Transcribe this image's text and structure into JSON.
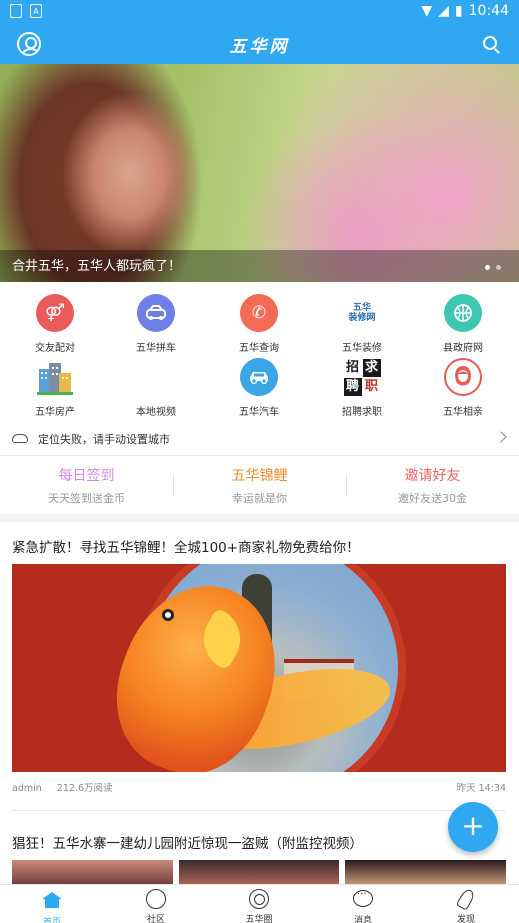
{
  "status_bar": {
    "time": "10:44"
  },
  "nav": {
    "title": "五华网"
  },
  "banner": {
    "caption": "合井五华，五华人都玩疯了！",
    "slide_count": 2,
    "active_slide": 1
  },
  "grid": [
    {
      "label": "交友配对",
      "icon": "gender-match-icon",
      "color": "#e95a5a",
      "glyph": "⚤"
    },
    {
      "label": "五华拼车",
      "icon": "car-share-icon",
      "color": "#6f7fe8",
      "glyph": "🚘"
    },
    {
      "label": "五华查询",
      "icon": "phone-icon",
      "color": "#f36a55",
      "glyph": "✆"
    },
    {
      "label": "五华装修",
      "icon": "renovation-logo-icon",
      "color": "#2a6db5",
      "glyph": "五华装修网"
    },
    {
      "label": "县政府网",
      "icon": "basketball-icon",
      "color": "#3dc6b0",
      "glyph": "◍"
    },
    {
      "label": "五华房产",
      "icon": "buildings-icon",
      "color": "#5aa0d8",
      "glyph": ""
    },
    {
      "label": "本地视频",
      "icon": "video-icon",
      "color": "#ffffff",
      "glyph": ""
    },
    {
      "label": "五华汽车",
      "icon": "car-icon",
      "color": "#3aa6e6",
      "glyph": "🚗"
    },
    {
      "label": "招聘求职",
      "icon": "recruit-logo-icon",
      "color": "#1a1a1a",
      "glyph": "招求聘职"
    },
    {
      "label": "五华相亲",
      "icon": "dating-portrait-icon",
      "color": "#e95a5a",
      "glyph": ""
    }
  ],
  "location": {
    "text": "定位失败，请手动设置城市"
  },
  "promos": [
    {
      "title": "每日签到",
      "subtitle": "天天签到送金币",
      "color": "#d48be6"
    },
    {
      "title": "五华锦鲤",
      "subtitle": "幸运就是你",
      "color": "#f08a2a"
    },
    {
      "title": "邀请好友",
      "subtitle": "邀好友送30金",
      "color": "#f06262"
    }
  ],
  "articles": [
    {
      "title": "紧急扩散！寻找五华锦鲤！全城100+商家礼物免费给你！",
      "author": "admin",
      "views": "212.6万阅读",
      "time": "昨天 14:34"
    },
    {
      "title": "猖狂！五华水寨一建幼儿园附近惊现一盗贼（附监控视频）"
    }
  ],
  "fab": {
    "label": "+"
  },
  "tabs": [
    {
      "label": "首页",
      "active": true
    },
    {
      "label": "社区",
      "active": false
    },
    {
      "label": "五华圈",
      "active": false
    },
    {
      "label": "消息",
      "active": false
    },
    {
      "label": "发现",
      "active": false
    }
  ],
  "colors": {
    "primary": "#2fa8f1"
  }
}
